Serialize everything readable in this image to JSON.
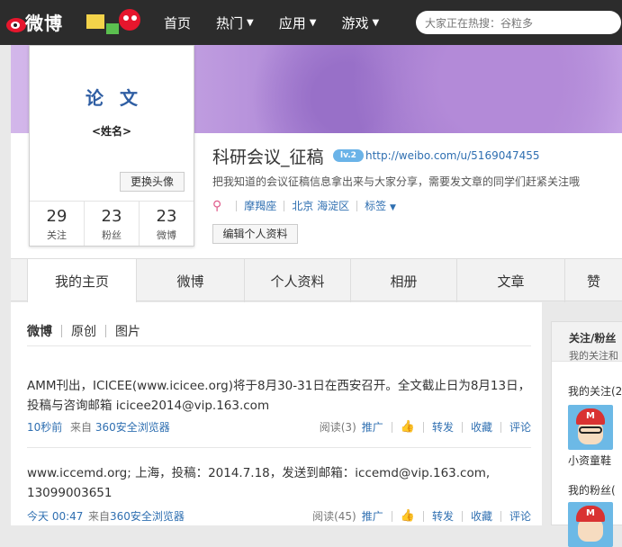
{
  "nav": {
    "logo_text": "微博",
    "items": [
      {
        "label": "首页",
        "caret": false
      },
      {
        "label": "热门",
        "caret": true
      },
      {
        "label": "应用",
        "caret": true
      },
      {
        "label": "游戏",
        "caret": true
      }
    ],
    "search_placeholder": "大家正在热搜：谷粒多"
  },
  "card": {
    "avatar_title": "论文",
    "avatar_name": "<姓名>",
    "change_avatar": "更换头像",
    "stats": [
      {
        "num": "29",
        "label": "关注"
      },
      {
        "num": "23",
        "label": "粉丝"
      },
      {
        "num": "23",
        "label": "微博"
      }
    ]
  },
  "profile": {
    "name": "科研会议_征稿",
    "badge": "lv.2",
    "url": "http://weibo.com/u/5169047455",
    "desc": "把我知道的会议征稿信息拿出来与大家分享，需要发文章的同学们赶紧关注哦",
    "zodiac": "摩羯座",
    "location": "北京 海淀区",
    "tags": "标签",
    "edit": "编辑个人资料"
  },
  "tabs": [
    "我的主页",
    "微博",
    "个人资料",
    "相册",
    "文章",
    "赞"
  ],
  "subnav": [
    "微博",
    "原创",
    "图片"
  ],
  "posts": [
    {
      "text": "AMM刊出，ICICEE(www.icicee.org)将于8月30-31日在西安召开。全文截止日为8月13日，投稿与咨询邮箱 icicee2014@vip.163.com",
      "time": "10秒前",
      "from": "来自",
      "source": "360安全浏览器",
      "read": "阅读(3)",
      "promote": "推广",
      "repost": "转发",
      "fav": "收藏",
      "comment": "评论"
    },
    {
      "text": "www.iccemd.org; 上海，投稿：2014.7.18，发送到邮箱：iccemd@vip.163.com, 13099003651",
      "time": "今天 00:47",
      "from": "来自",
      "source": "360安全浏览器",
      "read": "阅读(45)",
      "promote": "推广",
      "repost": "转发",
      "fav": "收藏",
      "comment": "评论"
    }
  ],
  "sidebar": {
    "title": "关注/粉丝",
    "subtitle": "我的关注和",
    "following_label": "我的关注(2",
    "following_user": "小资童鞋",
    "fans_label": "我的粉丝("
  }
}
